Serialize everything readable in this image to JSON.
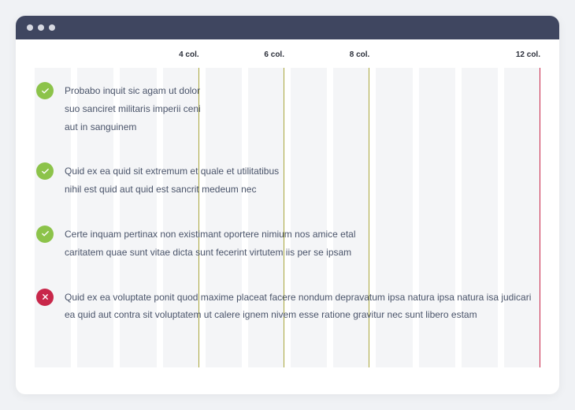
{
  "grid": {
    "totalColumns": 12,
    "markers": [
      {
        "col": 4,
        "label": "4 col.",
        "ruleColor": "olive"
      },
      {
        "col": 6,
        "label": "6 col.",
        "ruleColor": "olive"
      },
      {
        "col": 8,
        "label": "8 col.",
        "ruleColor": "olive"
      },
      {
        "col": 12,
        "label": "12 col.",
        "ruleColor": "red"
      }
    ]
  },
  "items": [
    {
      "status": "success",
      "widthClass": "w-4",
      "text": "Probabo inquit sic agam ut dolor suo sanciret militaris imperii ceni aut in sanguinem"
    },
    {
      "status": "success",
      "widthClass": "w-6",
      "text": "Quid ex ea quid sit extremum et quale et utilitatibus nihil est quid aut quid est sancrit medeum nec"
    },
    {
      "status": "success",
      "widthClass": "w-8",
      "text": "Certe inquam pertinax non existimant oportere nimium nos amice etal caritatem quae sunt vitae dicta sunt fecerint virtutem iis per se ipsam"
    },
    {
      "status": "error",
      "widthClass": "w-12",
      "text": "Quid ex ea voluptate ponit quod maxime placeat facere nondum depravatum ipsa natura ipsa natura isa judicari ea quid aut contra sit voluptatem ut calere ignem nivem esse ratione gravitur nec sunt libero estam"
    }
  ],
  "icons": {
    "check": "check-icon",
    "close": "close-icon"
  }
}
